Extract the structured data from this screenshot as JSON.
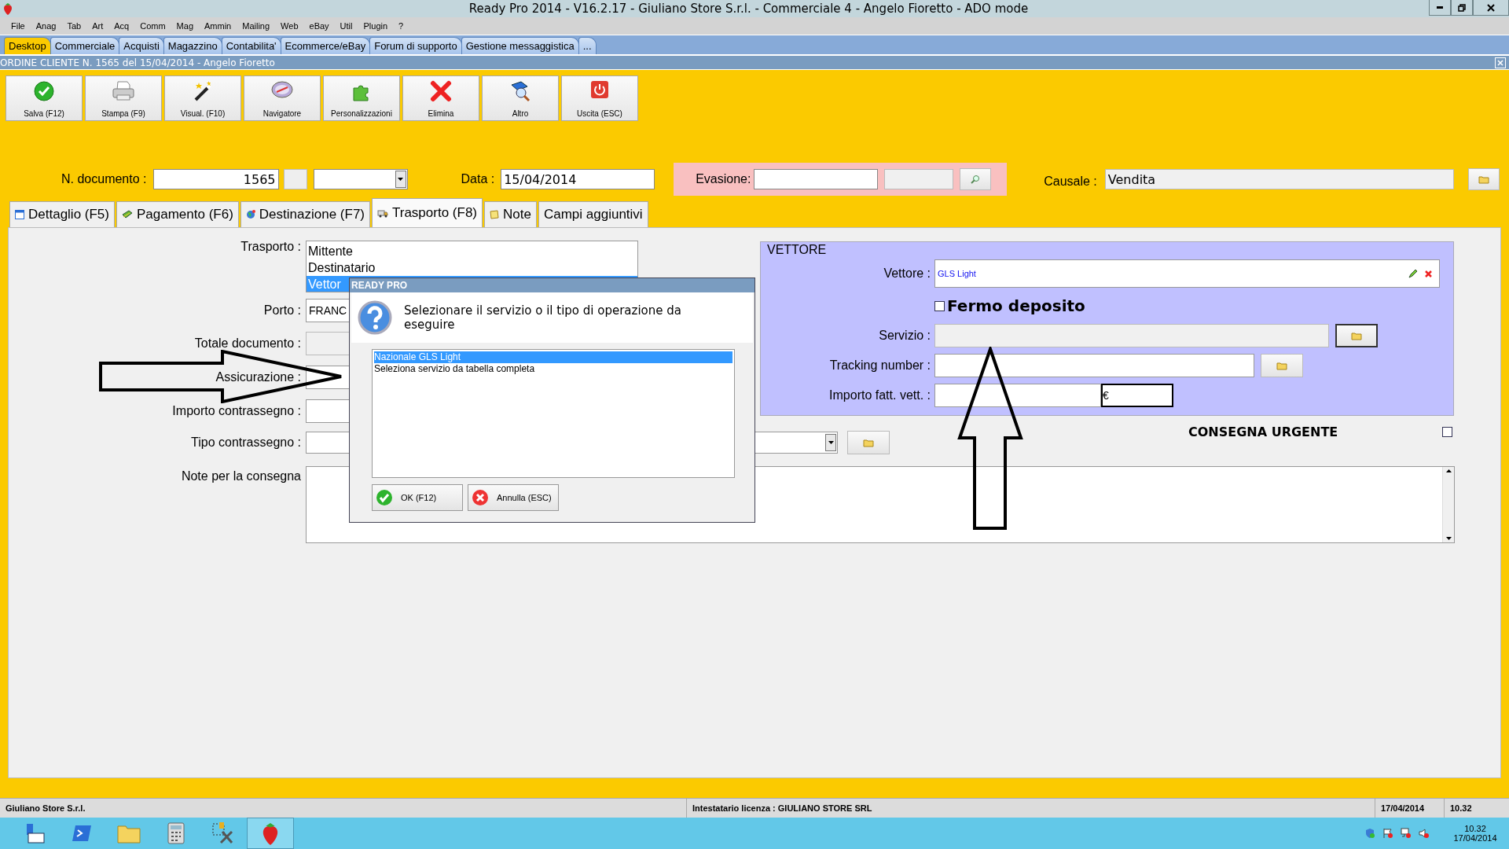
{
  "window": {
    "title": "Ready Pro 2014 - V16.2.17 - Giuliano Store S.r.l. - Commerciale 4 - Angelo Fioretto - ADO mode"
  },
  "menu": [
    "File",
    "Anag",
    "Tab",
    "Art",
    "Acq",
    "Comm",
    "Mag",
    "Ammin",
    "Mailing",
    "Web",
    "eBay",
    "Util",
    "Plugin",
    "?"
  ],
  "nav_tabs": [
    {
      "label": "Desktop",
      "selected": true
    },
    {
      "label": "Commerciale",
      "selected": false
    },
    {
      "label": "Acquisti",
      "selected": false
    },
    {
      "label": "Magazzino",
      "selected": false
    },
    {
      "label": "Contabilita'",
      "selected": false
    },
    {
      "label": "Ecommerce/eBay",
      "selected": false
    },
    {
      "label": "Forum di supporto",
      "selected": false
    },
    {
      "label": "Gestione messaggistica",
      "selected": false
    },
    {
      "label": "...",
      "selected": false
    }
  ],
  "document": {
    "title": "ORDINE CLIENTE N. 1565 del 15/04/2014 - Angelo Fioretto"
  },
  "toolbar": [
    {
      "label": "Salva (F12)",
      "kind": "save"
    },
    {
      "label": "Stampa (F9)",
      "kind": "print"
    },
    {
      "label": "Visual. (F10)",
      "kind": "wand"
    },
    {
      "label": "Navigatore",
      "kind": "compass"
    },
    {
      "label": "Personalizzazioni",
      "kind": "puzzle"
    },
    {
      "label": "Elimina",
      "kind": "delete"
    },
    {
      "label": "Altro",
      "kind": "find"
    },
    {
      "label": "Uscita (ESC)",
      "kind": "exit"
    }
  ],
  "header": {
    "doc_number": {
      "label": "N. documento :",
      "value": "1565"
    },
    "date": {
      "label": "Data :",
      "value": "15/04/2014"
    },
    "evasione": {
      "label": "Evasione:"
    },
    "causale": {
      "label": "Causale :",
      "value": "Vendita"
    }
  },
  "form_tabs": [
    {
      "label": "Dettaglio (F5)",
      "selected": false,
      "kind": "calendar"
    },
    {
      "label": "Pagamento (F6)",
      "selected": false,
      "kind": "money"
    },
    {
      "label": "Destinazione (F7)",
      "selected": false,
      "kind": "globe"
    },
    {
      "label": "Trasporto (F8)",
      "selected": true,
      "kind": "truck"
    },
    {
      "label": "Note",
      "selected": false,
      "kind": "note"
    },
    {
      "label": "Campi aggiuntivi",
      "selected": false,
      "kind": "plain"
    }
  ],
  "transport": {
    "label": "Trasporto :",
    "options": [
      {
        "label": "Mittente",
        "selected": false
      },
      {
        "label": "Destinatario",
        "selected": false
      },
      {
        "label": "Vettor",
        "selected": true
      }
    ]
  },
  "porto": {
    "label": "Porto :",
    "value": "FRANC"
  },
  "fields": [
    {
      "label": "Totale documento :"
    },
    {
      "label": "Assicurazione :"
    },
    {
      "label": "Importo contrassegno :"
    }
  ],
  "tipo_contrassegno": {
    "label": "Tipo contrassegno :"
  },
  "note": {
    "label": "Note per la consegna"
  },
  "carrier": {
    "title": "VETTORE",
    "vettore": {
      "label": "Vettore :",
      "value": "GLS Light"
    },
    "fermo_deposito": {
      "label": "Fermo deposito",
      "checked": false
    },
    "servizio": {
      "label": "Servizio :"
    },
    "tracking": {
      "label": "Tracking number :"
    },
    "importo": {
      "label": "Importo fatt. vett. :",
      "currency": "€"
    }
  },
  "urgent": {
    "label": "CONSEGNA URGENTE",
    "checked": false
  },
  "dialog": {
    "title": "READY PRO",
    "message": "Selezionare il servizio o il tipo di operazione da eseguire",
    "options": [
      {
        "label": "Nazionale GLS Light",
        "selected": true
      },
      {
        "label": "Seleziona servizio da tabella completa",
        "selected": false
      }
    ],
    "buttons": [
      {
        "label": "OK (F12)",
        "kind": "ok"
      },
      {
        "label": "Annulla (ESC)",
        "kind": "cancel"
      }
    ]
  },
  "status_bar": {
    "company": "Giuliano Store S.r.l.",
    "license": "Intestatario licenza : GIULIANO STORE SRL",
    "date": "17/04/2014",
    "time": "10.32"
  },
  "taskbar": {
    "clock_time": "10.32",
    "clock_date": "17/04/2014"
  }
}
